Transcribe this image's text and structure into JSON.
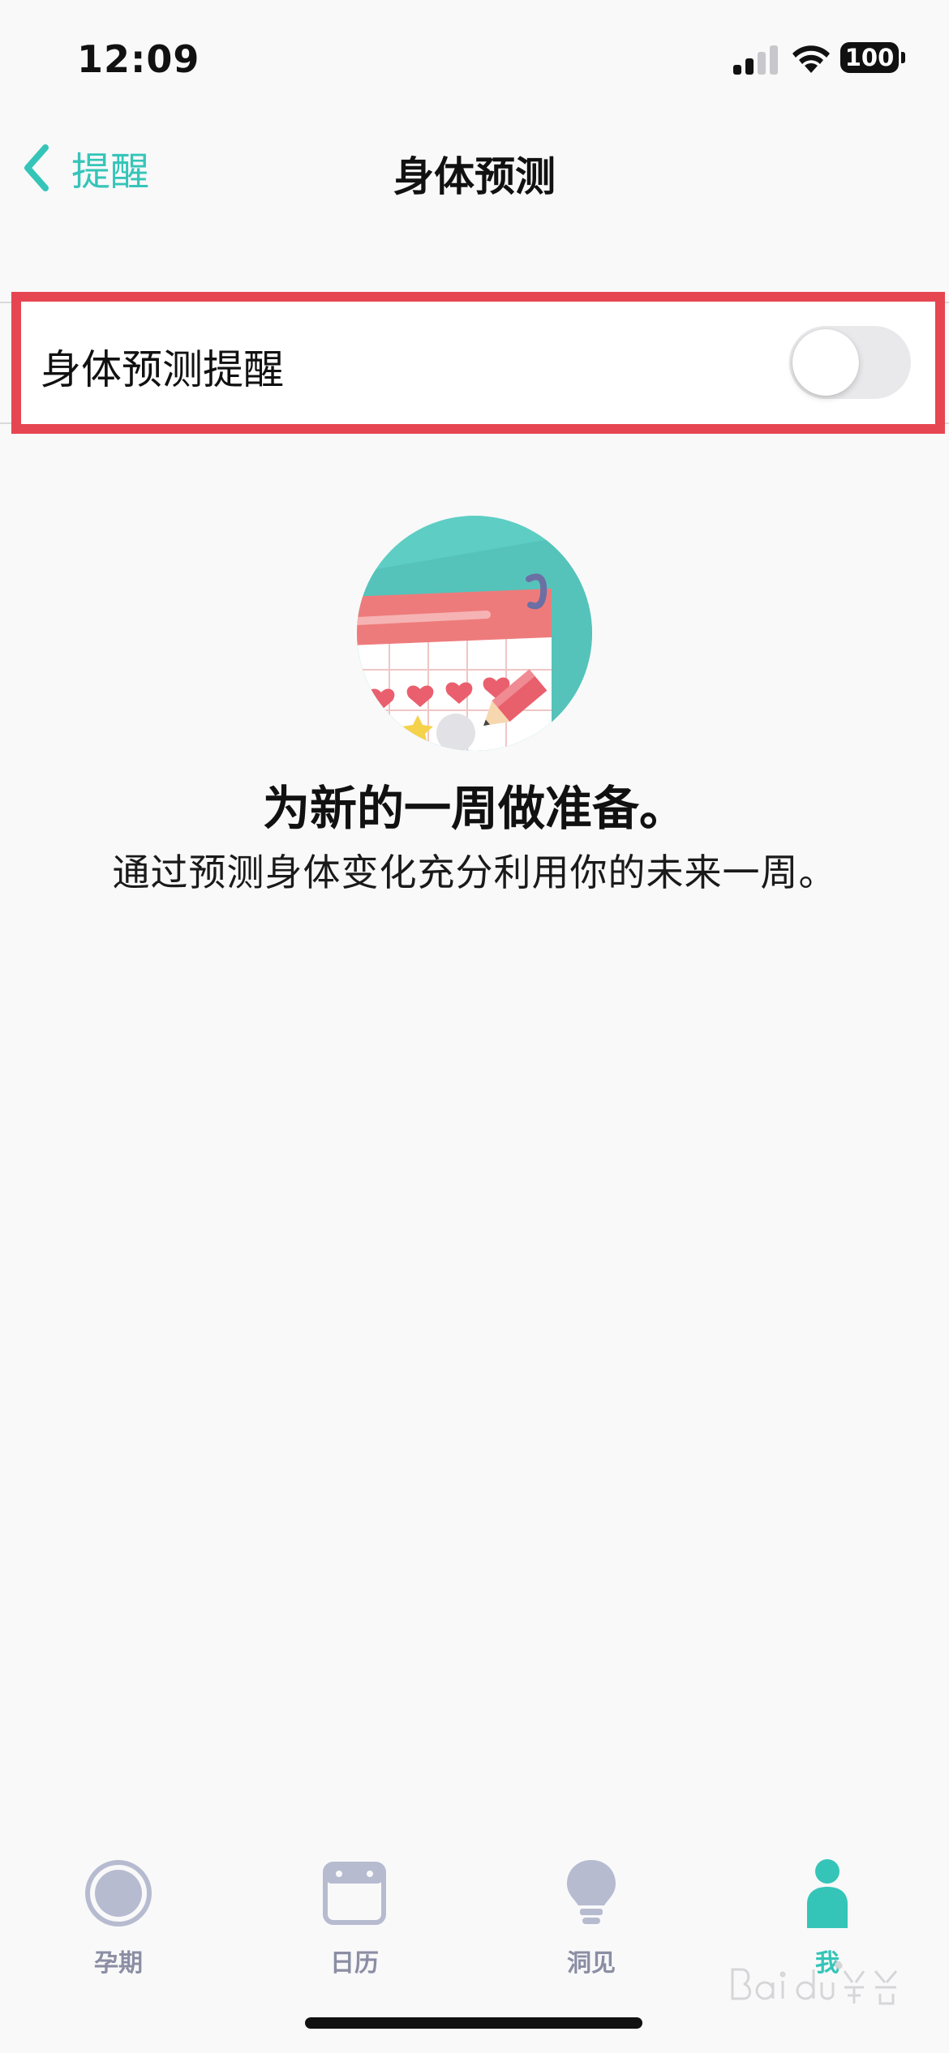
{
  "status_bar": {
    "time": "12:09",
    "battery": "100"
  },
  "nav": {
    "back_label": "提醒",
    "title": "身体预测"
  },
  "setting": {
    "label": "身体预测提醒",
    "toggle_on": false
  },
  "promo": {
    "headline": "为新的一周做准备。",
    "subline": "通过预测身体变化充分利用你的未来一周。"
  },
  "tabs": [
    {
      "label": "孕期",
      "icon": "pregnancy-circle-icon",
      "active": false
    },
    {
      "label": "日历",
      "icon": "calendar-icon",
      "active": false
    },
    {
      "label": "洞见",
      "icon": "lightbulb-icon",
      "active": false
    },
    {
      "label": "我",
      "icon": "person-icon",
      "active": true
    }
  ],
  "colors": {
    "accent": "#35c5b8",
    "highlight_border": "#e64651",
    "tab_inactive": "#8b8ea3",
    "tab_icon_inactive": "#b7bbd0"
  }
}
